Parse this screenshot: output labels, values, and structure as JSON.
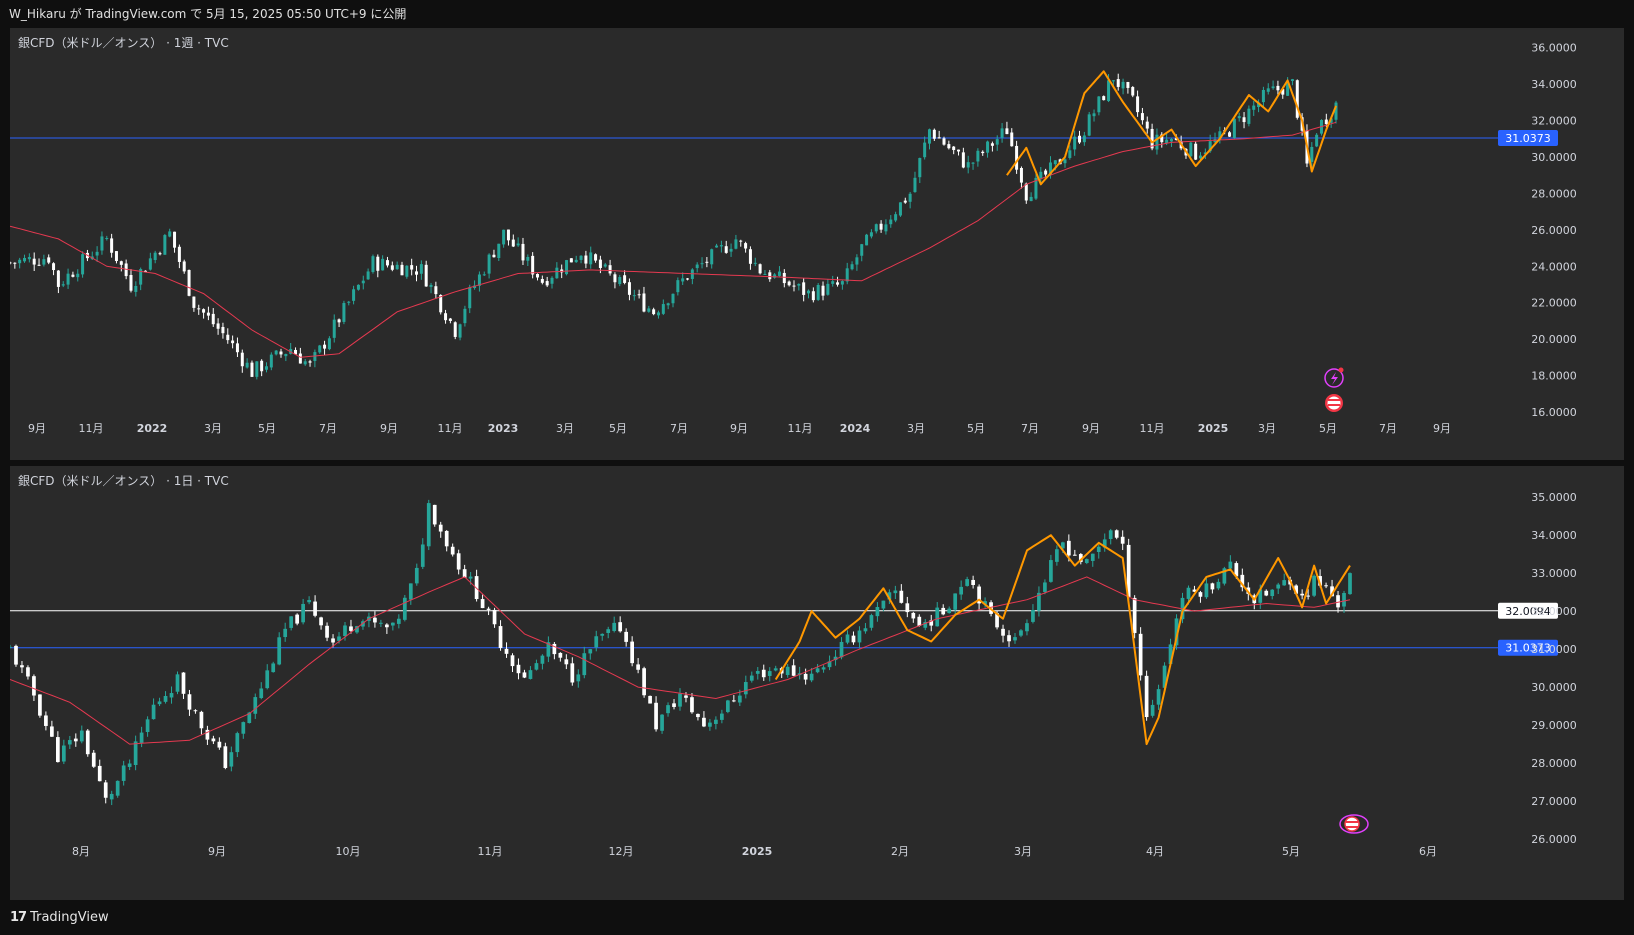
{
  "header": {
    "published": "W_Hikaru が TradingView.com で 5月 15, 2025 05:50 UTC+9 に公開"
  },
  "footer": {
    "brand": "TradingView",
    "brand_mark": "17"
  },
  "colors": {
    "bg": "#2a2a2a",
    "up": "#26a69a",
    "down": "#ffffff",
    "ma": "#e53950",
    "orange": "#ff9800",
    "hline_blue": "#2962ff",
    "hline_white": "#ffffff"
  },
  "chart_data": [
    {
      "type": "candlestick",
      "title": "銀CFD（米ドル／オンス） · 1週 · TVC",
      "y_ticks": [
        "36.0000",
        "34.0000",
        "32.0000",
        "30.0000",
        "28.0000",
        "26.0000",
        "24.0000",
        "22.0000",
        "20.0000",
        "18.0000",
        "16.0000"
      ],
      "ylim": [
        16,
        36.2
      ],
      "x_ticks": [
        "9月",
        "11月",
        "2022",
        "3月",
        "5月",
        "7月",
        "9月",
        "11月",
        "2023",
        "3月",
        "5月",
        "7月",
        "9月",
        "11月",
        "2024",
        "3月",
        "5月",
        "7月",
        "9月",
        "11月",
        "2025",
        "3月",
        "5月",
        "7月",
        "9月"
      ],
      "bold_ticks": [
        "2022",
        "2023",
        "2024",
        "2025"
      ],
      "hline": {
        "value": 31.0373,
        "label": "31.0373",
        "color": "blue"
      },
      "close_anchors": [
        [
          0,
          24.2
        ],
        [
          8,
          24.5
        ],
        [
          10,
          23.0
        ],
        [
          20,
          25.5
        ],
        [
          25,
          23.0
        ],
        [
          33,
          25.8
        ],
        [
          38,
          22.0
        ],
        [
          45,
          20.0
        ],
        [
          50,
          18.2
        ],
        [
          58,
          19.5
        ],
        [
          62,
          18.5
        ],
        [
          70,
          22.0
        ],
        [
          75,
          24.2
        ],
        [
          85,
          23.8
        ],
        [
          92,
          20.5
        ],
        [
          95,
          22.5
        ],
        [
          102,
          25.8
        ],
        [
          110,
          23.2
        ],
        [
          118,
          24.8
        ],
        [
          126,
          23.0
        ],
        [
          133,
          21.5
        ],
        [
          140,
          23.5
        ],
        [
          150,
          25.5
        ],
        [
          155,
          23.8
        ],
        [
          165,
          22.5
        ],
        [
          172,
          23.0
        ],
        [
          176,
          25.0
        ],
        [
          186,
          28.0
        ],
        [
          190,
          31.5
        ],
        [
          198,
          29.5
        ],
        [
          206,
          31.5
        ],
        [
          210,
          28.0
        ],
        [
          216,
          29.5
        ],
        [
          222,
          31.5
        ],
        [
          228,
          34.4
        ],
        [
          232,
          33.0
        ],
        [
          236,
          30.8
        ],
        [
          240,
          31.0
        ],
        [
          245,
          30.2
        ],
        [
          250,
          31.0
        ],
        [
          256,
          32.5
        ],
        [
          260,
          33.5
        ],
        [
          265,
          34.0
        ],
        [
          268,
          29.5
        ],
        [
          270,
          31.5
        ],
        [
          274,
          32.9
        ]
      ],
      "ma_anchors": [
        [
          0,
          26.2
        ],
        [
          10,
          25.5
        ],
        [
          20,
          24.0
        ],
        [
          30,
          23.6
        ],
        [
          40,
          22.5
        ],
        [
          50,
          20.5
        ],
        [
          60,
          19.0
        ],
        [
          68,
          19.2
        ],
        [
          80,
          21.5
        ],
        [
          92,
          22.6
        ],
        [
          105,
          23.6
        ],
        [
          120,
          23.8
        ],
        [
          140,
          23.6
        ],
        [
          160,
          23.4
        ],
        [
          176,
          23.2
        ],
        [
          190,
          25.0
        ],
        [
          200,
          26.5
        ],
        [
          210,
          28.5
        ],
        [
          220,
          29.5
        ],
        [
          230,
          30.3
        ],
        [
          240,
          30.8
        ],
        [
          255,
          31.0
        ],
        [
          265,
          31.2
        ],
        [
          274,
          31.9
        ]
      ],
      "orange_anchors": [
        [
          206,
          29.0
        ],
        [
          210,
          30.5
        ],
        [
          213,
          28.5
        ],
        [
          218,
          30.0
        ],
        [
          222,
          33.5
        ],
        [
          226,
          34.7
        ],
        [
          230,
          33.0
        ],
        [
          236,
          30.8
        ],
        [
          240,
          31.5
        ],
        [
          245,
          29.5
        ],
        [
          250,
          31.0
        ],
        [
          256,
          33.4
        ],
        [
          260,
          32.5
        ],
        [
          264,
          34.2
        ],
        [
          267,
          32.0
        ],
        [
          269,
          29.2
        ],
        [
          272,
          31.5
        ],
        [
          274,
          32.8
        ]
      ],
      "n": 275
    },
    {
      "type": "candlestick",
      "title": "銀CFD（米ドル／オンス） · 1日 · TVC",
      "y_ticks": [
        "35.0000",
        "34.0000",
        "33.0000",
        "32.0000",
        "31.0000",
        "30.0000",
        "29.0000",
        "28.0000",
        "27.0000",
        "26.0000"
      ],
      "ylim": [
        25.5,
        35.4
      ],
      "x_ticks": [
        "8月",
        "9月",
        "10月",
        "11月",
        "12月",
        "2025",
        "2月",
        "3月",
        "4月",
        "5月",
        "6月"
      ],
      "bold_ticks": [
        "2025"
      ],
      "hline": {
        "value": 31.0373,
        "label": "31.0373",
        "color": "blue"
      },
      "hline2": {
        "value": 32.0094,
        "label": "32.0094",
        "color": "white"
      },
      "close_anchors": [
        [
          0,
          31.0
        ],
        [
          4,
          29.8
        ],
        [
          8,
          28.2
        ],
        [
          12,
          28.8
        ],
        [
          16,
          27.0
        ],
        [
          20,
          28.0
        ],
        [
          24,
          29.5
        ],
        [
          28,
          30.2
        ],
        [
          32,
          29.0
        ],
        [
          36,
          28.0
        ],
        [
          42,
          30.0
        ],
        [
          46,
          31.5
        ],
        [
          50,
          32.2
        ],
        [
          54,
          31.2
        ],
        [
          58,
          31.8
        ],
        [
          64,
          31.5
        ],
        [
          68,
          33.0
        ],
        [
          70,
          34.8
        ],
        [
          74,
          33.5
        ],
        [
          78,
          32.5
        ],
        [
          82,
          31.2
        ],
        [
          86,
          30.2
        ],
        [
          90,
          31.0
        ],
        [
          94,
          30.3
        ],
        [
          98,
          31.2
        ],
        [
          102,
          31.6
        ],
        [
          104,
          30.8
        ],
        [
          108,
          29.0
        ],
        [
          112,
          29.8
        ],
        [
          116,
          29.0
        ],
        [
          120,
          29.5
        ],
        [
          124,
          30.3
        ],
        [
          128,
          30.5
        ],
        [
          134,
          30.3
        ],
        [
          140,
          31.2
        ],
        [
          144,
          31.8
        ],
        [
          148,
          32.5
        ],
        [
          152,
          31.6
        ],
        [
          156,
          32.0
        ],
        [
          160,
          33.0
        ],
        [
          164,
          31.8
        ],
        [
          168,
          31.2
        ],
        [
          172,
          32.5
        ],
        [
          176,
          33.8
        ],
        [
          180,
          33.2
        ],
        [
          184,
          34.2
        ],
        [
          186,
          33.6
        ],
        [
          188,
          31.5
        ],
        [
          190,
          29.2
        ],
        [
          192,
          30.0
        ],
        [
          196,
          32.4
        ],
        [
          200,
          32.6
        ],
        [
          204,
          33.2
        ],
        [
          208,
          32.3
        ],
        [
          212,
          32.6
        ],
        [
          214,
          32.9
        ],
        [
          216,
          32.3
        ],
        [
          218,
          32.8
        ],
        [
          220,
          32.6
        ],
        [
          222,
          32.2
        ],
        [
          224,
          32.9
        ]
      ],
      "ma_anchors": [
        [
          0,
          30.2
        ],
        [
          10,
          29.6
        ],
        [
          20,
          28.5
        ],
        [
          30,
          28.6
        ],
        [
          40,
          29.3
        ],
        [
          50,
          30.6
        ],
        [
          60,
          31.8
        ],
        [
          70,
          32.5
        ],
        [
          76,
          32.9
        ],
        [
          86,
          31.4
        ],
        [
          95,
          30.8
        ],
        [
          105,
          30.0
        ],
        [
          118,
          29.7
        ],
        [
          130,
          30.2
        ],
        [
          142,
          31.0
        ],
        [
          155,
          31.8
        ],
        [
          170,
          32.3
        ],
        [
          180,
          32.9
        ],
        [
          188,
          32.3
        ],
        [
          198,
          32.0
        ],
        [
          210,
          32.2
        ],
        [
          218,
          32.1
        ],
        [
          224,
          32.3
        ]
      ],
      "orange_anchors": [
        [
          128,
          30.2
        ],
        [
          132,
          31.2
        ],
        [
          134,
          32.0
        ],
        [
          138,
          31.3
        ],
        [
          142,
          31.8
        ],
        [
          146,
          32.6
        ],
        [
          150,
          31.5
        ],
        [
          154,
          31.2
        ],
        [
          158,
          31.9
        ],
        [
          162,
          32.3
        ],
        [
          166,
          31.8
        ],
        [
          170,
          33.6
        ],
        [
          174,
          34.0
        ],
        [
          178,
          33.2
        ],
        [
          182,
          33.8
        ],
        [
          186,
          33.4
        ],
        [
          188,
          31.0
        ],
        [
          190,
          28.5
        ],
        [
          192,
          29.2
        ],
        [
          196,
          32.0
        ],
        [
          200,
          32.9
        ],
        [
          204,
          33.1
        ],
        [
          208,
          32.3
        ],
        [
          212,
          33.4
        ],
        [
          214,
          32.8
        ],
        [
          216,
          32.1
        ],
        [
          218,
          33.2
        ],
        [
          220,
          32.2
        ],
        [
          224,
          33.2
        ]
      ],
      "n": 225
    }
  ]
}
